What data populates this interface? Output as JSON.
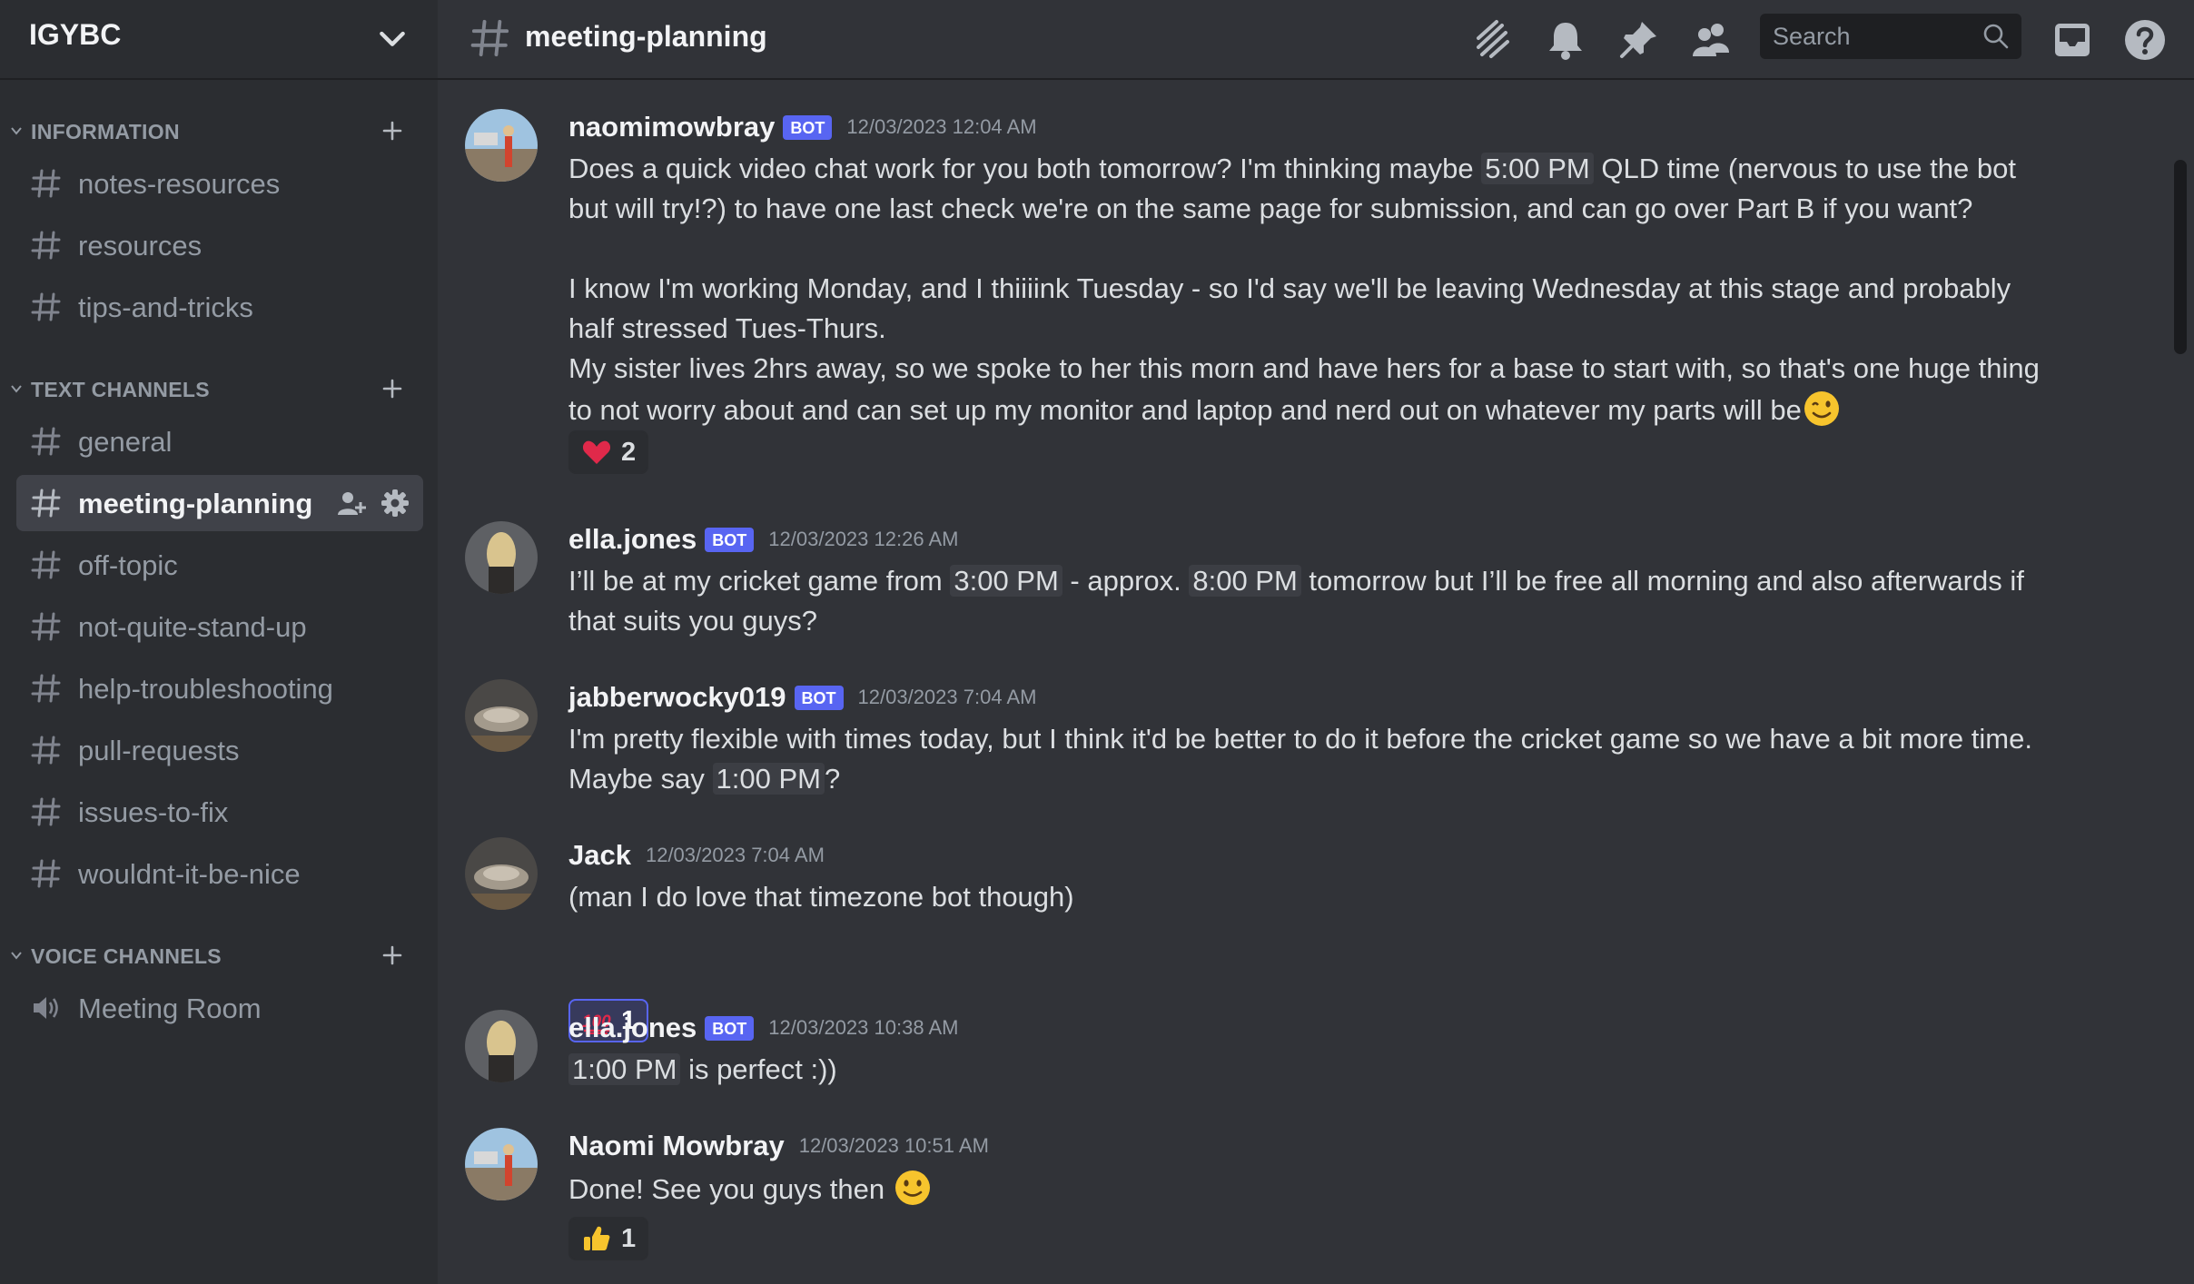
{
  "server": {
    "name": "IGYBC"
  },
  "categories": [
    {
      "label": "INFORMATION"
    },
    {
      "label": "TEXT CHANNELS"
    },
    {
      "label": "VOICE CHANNELS"
    }
  ],
  "channels": {
    "information": [
      {
        "label": "notes-resources"
      },
      {
        "label": "resources"
      },
      {
        "label": "tips-and-tricks"
      }
    ],
    "text": [
      {
        "label": "general"
      },
      {
        "label": "meeting-planning"
      },
      {
        "label": "off-topic"
      },
      {
        "label": "not-quite-stand-up"
      },
      {
        "label": "help-troubleshooting"
      },
      {
        "label": "pull-requests"
      },
      {
        "label": "issues-to-fix"
      },
      {
        "label": "wouldnt-it-be-nice"
      }
    ],
    "voice": [
      {
        "label": "Meeting Room"
      }
    ]
  },
  "header": {
    "channel": "meeting-planning",
    "search_placeholder": "Search",
    "icons": [
      "threads-icon",
      "bell-icon",
      "pin-icon",
      "members-icon",
      "inbox-icon",
      "help-icon"
    ]
  },
  "messages": [
    {
      "user": "naomimowbray",
      "bot": "BOT",
      "time": "12/03/2023 12:04 AM",
      "p1a": "Does a quick video chat work for you both tomorrow? I'm thinking maybe ",
      "t1": "5:00 PM",
      "p1b": " QLD time (nervous to use the bot but will try!?) to have one last check we're on the same page for submission, and can go over Part B if you want?",
      "p2": "I know I'm working Monday, and I thiiiink Tuesday - so I'd say we'll be leaving Wednesday at this stage and probably half stressed Tues-Thurs.",
      "p3": "My sister lives 2hrs away, so we spoke to her this morn and have hers for a base to start with, so that's one huge thing to not worry about and can set up my monitor and laptop and nerd out on whatever my parts will be",
      "reaction": {
        "emoji": "heart",
        "count": "2"
      }
    },
    {
      "user": "ella.jones",
      "bot": "BOT",
      "time": "12/03/2023 12:26 AM",
      "pa": "I’ll be at my cricket game from ",
      "t1": "3:00 PM",
      "pb": " - approx. ",
      "t2": "8:00 PM",
      "pc": " tomorrow but I’ll be free all morning and also afterwards if that suits you guys?"
    },
    {
      "user": "jabberwocky019",
      "bot": "BOT",
      "time": "12/03/2023 7:04 AM",
      "pa": "I'm pretty flexible with times today, but I think it'd be better to do it before the cricket game so we have a bit more time. Maybe say ",
      "t1": "1:00 PM",
      "pb": "?"
    },
    {
      "user": "Jack",
      "time": "12/03/2023 7:04 AM",
      "pa": "(man I do love that timezone bot though)",
      "reaction": {
        "emoji": "100",
        "count": "1"
      }
    },
    {
      "user": "ella.jones",
      "bot": "BOT",
      "time": "12/03/2023 10:38 AM",
      "t1": "1:00 PM",
      "pa": " is perfect :))"
    },
    {
      "user": "Naomi Mowbray",
      "time": "12/03/2023 10:51 AM",
      "pa": "Done! See you guys then",
      "reaction": {
        "emoji": "thumbs-up",
        "count": "1"
      }
    }
  ],
  "colors": {
    "background": "#313338",
    "sidebar": "#2b2d31",
    "bot_tag": "#5865f2",
    "active_channel": "#404249"
  }
}
